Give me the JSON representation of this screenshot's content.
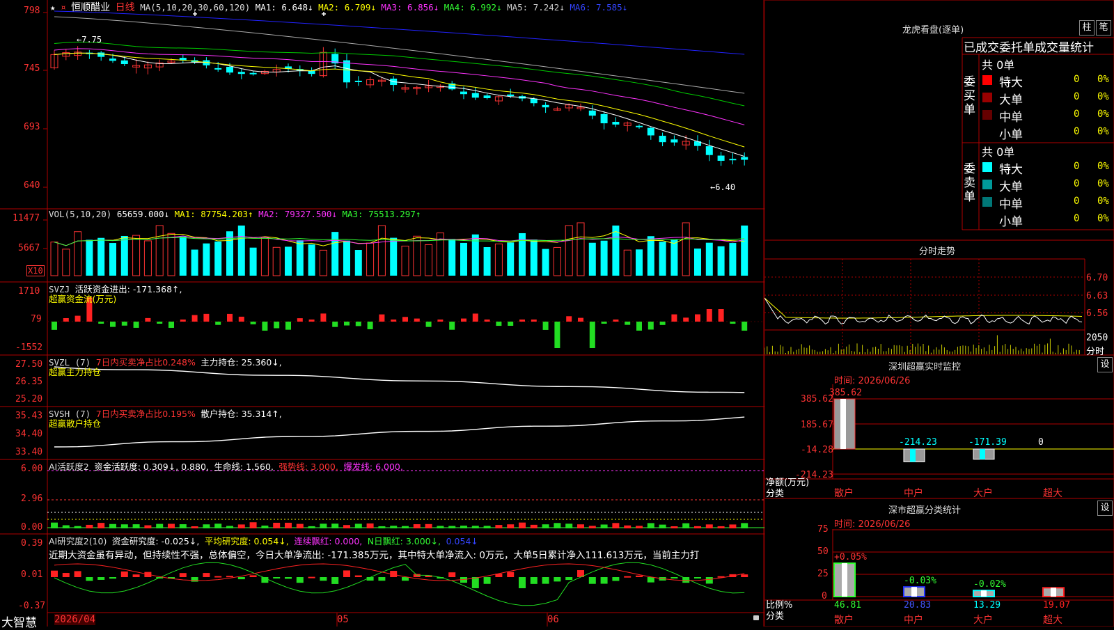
{
  "header": {
    "star": "★",
    "stock_name": "恒顺醋业",
    "period": "日线",
    "ma_title": "MA(5,10,20,30,60,120)",
    "ma1": "MA1: 6.648↓",
    "ma2": "MA2: 6.709↓",
    "ma3": "MA3: 6.856↓",
    "ma4": "MA4: 6.992↓",
    "ma5": "MA5: 7.242↓",
    "ma6": "MA6: 7.585↓",
    "high_marker": "←7.75",
    "low_marker": "←6.40"
  },
  "price_axis": [
    "798",
    "745",
    "693",
    "640"
  ],
  "vol": {
    "title": "VOL(5,10,20)",
    "value": "65659.000↓",
    "ma1": "MA1: 87754.203↑",
    "ma2": "MA2: 79327.500↓",
    "ma3": "MA3: 75513.297↑",
    "axis": [
      "11477",
      "5667"
    ],
    "unit": "X10"
  },
  "svzj": {
    "title": "SVZJ",
    "label": "活跃资金进出: -171.368↑,",
    "subtitle": "超赢资金流(万元)",
    "axis": [
      "1710",
      "79",
      "-1552"
    ]
  },
  "svzl": {
    "title": "SVZL (7)",
    "label1": "7日内买卖净占比0.248%",
    "label2": "主力持仓: 25.360↓,",
    "subtitle": "超赢主力持仓",
    "axis": [
      "27.50",
      "26.35",
      "25.20"
    ]
  },
  "svsh": {
    "title": "SVSH (7)",
    "label1": "7日内买卖净占比0.195%",
    "label2": "散户持仓: 35.314↑,",
    "subtitle": "超赢散户持仓",
    "axis": [
      "35.43",
      "34.40",
      "33.40"
    ]
  },
  "ai1": {
    "title": "AI活跃度2",
    "label1": "资金活跃度: 0.309↓, 0.880,",
    "label2": "生命线: 1.560,",
    "label3": "强势线: 3.000,",
    "label4": "爆发线: 6.000,",
    "axis": [
      "6.00",
      "2.96",
      "0.00"
    ]
  },
  "ai2": {
    "title": "AI研究度2(10)",
    "label1": "资金研究度: -0.025↓,",
    "label2": "平均研究度: 0.054↓,",
    "label3": "连续飘红: 0.000,",
    "label4": "N日飘红: 3.000↓,",
    "label5": "0.054↓",
    "text": "近期大资金虽有异动，但持续性不强，总体偏空，今日大单净流出: -171.385万元，其中特大单净流入: 0万元，大单5日累计净入111.613万元，当前主力打",
    "axis": [
      "0.39",
      "0.01",
      "-0.37"
    ]
  },
  "footer": {
    "brand": "大智慧",
    "date1": "2026/04",
    "date2": "05",
    "date3": "06"
  },
  "lhkp": {
    "title": "龙虎看盘(逐单)",
    "btn1": "柱",
    "btn2": "笔",
    "subtitle": "已成交委托单成交量统计",
    "buy": {
      "side": "委买单",
      "total": "共 0单",
      "rows": [
        {
          "name": "特大",
          "count": "0",
          "pct": "0%",
          "color": "#ff0000"
        },
        {
          "name": "大单",
          "count": "0",
          "pct": "0%",
          "color": "#990000"
        },
        {
          "name": "中单",
          "count": "0",
          "pct": "0%",
          "color": "#660000"
        },
        {
          "name": "小单",
          "count": "0",
          "pct": "0%",
          "color": "#000000"
        }
      ]
    },
    "sell": {
      "side": "委卖单",
      "total": "共 0单",
      "rows": [
        {
          "name": "特大",
          "count": "0",
          "pct": "0%",
          "color": "#00ffff"
        },
        {
          "name": "大单",
          "count": "0",
          "pct": "0%",
          "color": "#009999"
        },
        {
          "name": "中单",
          "count": "0",
          "pct": "0%",
          "color": "#007777"
        },
        {
          "name": "小单",
          "count": "0",
          "pct": "0%",
          "color": "#000000"
        }
      ]
    }
  },
  "fszs": {
    "title": "分时走势",
    "axis": [
      "6.70",
      "6.63",
      "6.56",
      "2050"
    ],
    "unit": "分时"
  },
  "szjk": {
    "title": "深圳超赢实时监控",
    "btn": "设",
    "time": "时间: 2026/06/26",
    "axis": [
      "385.62",
      "185.67",
      "-14.28",
      "-214.23"
    ],
    "ylabel": "净额(万元)",
    "xlabel": "分类",
    "bars": [
      {
        "name": "散户",
        "value": 385.62,
        "label": "385.62"
      },
      {
        "name": "中户",
        "value": -214.23,
        "label": "-214.23"
      },
      {
        "name": "大户",
        "value": -171.39,
        "label": "-171.39"
      },
      {
        "name": "超大",
        "value": 0,
        "label": "0"
      }
    ]
  },
  "sstj": {
    "title": "深市超赢分类统计",
    "btn": "设",
    "time": "时间: 2026/06/26",
    "axis": [
      "75",
      "50",
      "25",
      "0"
    ],
    "ylabel": "比例%",
    "xlabel": "分类",
    "bars": [
      {
        "name": "散户",
        "value": 46.81,
        "label": "46.81",
        "change": "+0.05%",
        "color": "#33ff33"
      },
      {
        "name": "中户",
        "value": 20.83,
        "label": "20.83",
        "change": "-0.03%",
        "color": "#2233ff"
      },
      {
        "name": "大户",
        "value": 13.29,
        "label": "13.29",
        "change": "-0.02%",
        "color": "#00ffff"
      },
      {
        "name": "超大",
        "value": 19.07,
        "label": "19.07",
        "change": "",
        "color": "#ff2222"
      }
    ]
  },
  "colors": {
    "up": "#ff3333",
    "down": "#00ffff",
    "grid": "#b00000",
    "ma1": "#ffffff",
    "ma2": "#ffff00",
    "ma3": "#ff33ff",
    "ma4": "#00cc00",
    "ma5": "#aaaaaa",
    "ma6": "#2222ff"
  }
}
